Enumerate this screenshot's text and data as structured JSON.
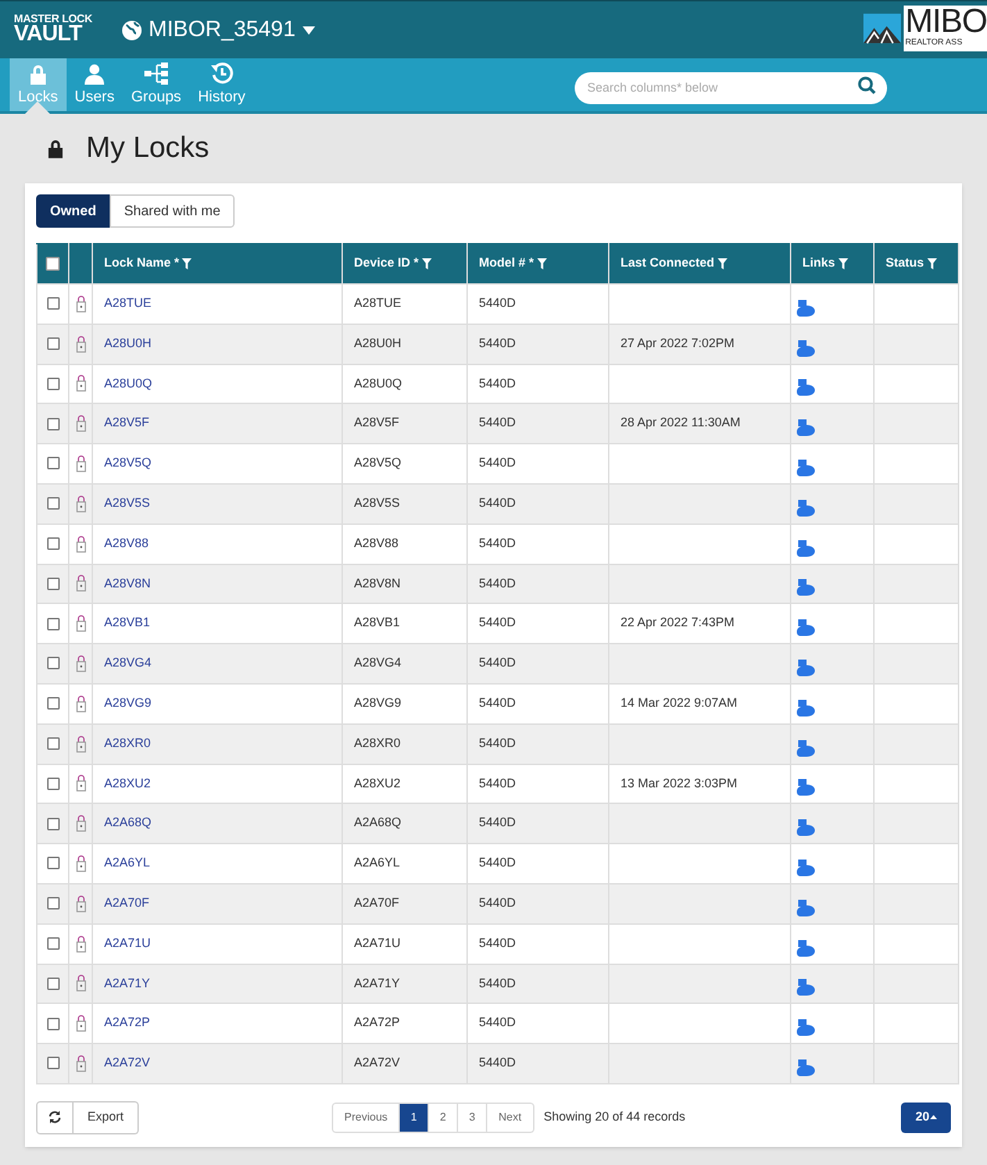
{
  "header": {
    "logo_top": "MASTER LOCK",
    "logo_bottom": "VAULT",
    "account": "MIBOR_35491",
    "partner_logo_name": "MIBO",
    "partner_logo_tagline": "REALTOR ASS"
  },
  "nav": [
    {
      "label": "Locks",
      "selected": true
    },
    {
      "label": "Users",
      "selected": false
    },
    {
      "label": "Groups",
      "selected": false
    },
    {
      "label": "History",
      "selected": false
    }
  ],
  "search": {
    "placeholder": "Search columns* below"
  },
  "page_title": "My Locks",
  "tabs": [
    {
      "label": "Owned",
      "selected": true
    },
    {
      "label": "Shared with me",
      "selected": false
    }
  ],
  "table": {
    "select_all_checked": false,
    "columns": [
      "Lock Name *",
      "Device ID *",
      "Model # *",
      "Last Connected",
      "Links",
      "Status"
    ],
    "rows": [
      {
        "lock_name": "A28TUE",
        "device_id": "A28TUE",
        "model": "5440D",
        "last_connected": "",
        "checked": false
      },
      {
        "lock_name": "A28U0H",
        "device_id": "A28U0H",
        "model": "5440D",
        "last_connected": "27 Apr 2022 7:02PM",
        "checked": false
      },
      {
        "lock_name": "A28U0Q",
        "device_id": "A28U0Q",
        "model": "5440D",
        "last_connected": "",
        "checked": false
      },
      {
        "lock_name": "A28V5F",
        "device_id": "A28V5F",
        "model": "5440D",
        "last_connected": "28 Apr 2022 11:30AM",
        "checked": false
      },
      {
        "lock_name": "A28V5Q",
        "device_id": "A28V5Q",
        "model": "5440D",
        "last_connected": "",
        "checked": false
      },
      {
        "lock_name": "A28V5S",
        "device_id": "A28V5S",
        "model": "5440D",
        "last_connected": "",
        "checked": false
      },
      {
        "lock_name": "A28V88",
        "device_id": "A28V88",
        "model": "5440D",
        "last_connected": "",
        "checked": false
      },
      {
        "lock_name": "A28V8N",
        "device_id": "A28V8N",
        "model": "5440D",
        "last_connected": "",
        "checked": false
      },
      {
        "lock_name": "A28VB1",
        "device_id": "A28VB1",
        "model": "5440D",
        "last_connected": "22 Apr 2022 7:43PM",
        "checked": false
      },
      {
        "lock_name": "A28VG4",
        "device_id": "A28VG4",
        "model": "5440D",
        "last_connected": "",
        "checked": false
      },
      {
        "lock_name": "A28VG9",
        "device_id": "A28VG9",
        "model": "5440D",
        "last_connected": "14 Mar 2022 9:07AM",
        "checked": false
      },
      {
        "lock_name": "A28XR0",
        "device_id": "A28XR0",
        "model": "5440D",
        "last_connected": "",
        "checked": false
      },
      {
        "lock_name": "A28XU2",
        "device_id": "A28XU2",
        "model": "5440D",
        "last_connected": "13 Mar 2022 3:03PM",
        "checked": false
      },
      {
        "lock_name": "A2A68Q",
        "device_id": "A2A68Q",
        "model": "5440D",
        "last_connected": "",
        "checked": false
      },
      {
        "lock_name": "A2A6YL",
        "device_id": "A2A6YL",
        "model": "5440D",
        "last_connected": "",
        "checked": false
      },
      {
        "lock_name": "A2A70F",
        "device_id": "A2A70F",
        "model": "5440D",
        "last_connected": "",
        "checked": false
      },
      {
        "lock_name": "A2A71U",
        "device_id": "A2A71U",
        "model": "5440D",
        "last_connected": "",
        "checked": false
      },
      {
        "lock_name": "A2A71Y",
        "device_id": "A2A71Y",
        "model": "5440D",
        "last_connected": "",
        "checked": false
      },
      {
        "lock_name": "A2A72P",
        "device_id": "A2A72P",
        "model": "5440D",
        "last_connected": "",
        "checked": false
      },
      {
        "lock_name": "A2A72V",
        "device_id": "A2A72V",
        "model": "5440D",
        "last_connected": "",
        "checked": false
      }
    ]
  },
  "export_button": "Export",
  "pagination": [
    {
      "label": "Previous",
      "selected": false
    },
    {
      "label": "1",
      "selected": true
    },
    {
      "label": "2",
      "selected": false
    },
    {
      "label": "3",
      "selected": false
    },
    {
      "label": "Next",
      "selected": false
    }
  ],
  "records_summary": "Showing 20 of 44 records",
  "page_size": "20"
}
